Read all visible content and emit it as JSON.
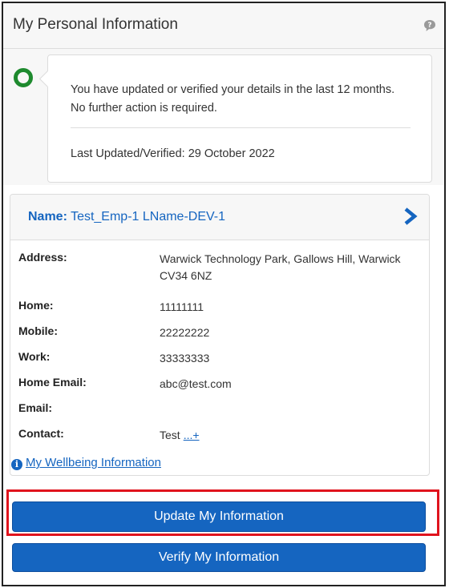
{
  "panel": {
    "title": "My Personal Information",
    "help_icon": "question-bubble-icon"
  },
  "status": {
    "icon": "circle-ring-icon",
    "icon_color": "#1e8a2e",
    "message_line1": "You have updated or verified your details in the last 12 months.",
    "message_line2": "No further action is required.",
    "last_updated": "Last Updated/Verified: 29 October 2022"
  },
  "person": {
    "name_label": "Name:",
    "name_value": "Test_Emp-1 LName-DEV-1",
    "chevron_icon": "chevron-right-icon",
    "fields": [
      {
        "key": "Address:",
        "value": "Warwick Technology Park, Gallows Hill, Warwick CV34 6NZ"
      },
      {
        "key": "Home:",
        "value": "11111111"
      },
      {
        "key": "Mobile:",
        "value": "22222222"
      },
      {
        "key": "Work:",
        "value": "33333333"
      },
      {
        "key": "Home Email:",
        "value": "abc@test.com"
      },
      {
        "key": "Email:",
        "value": ""
      },
      {
        "key": "Contact:",
        "value": "Test",
        "more": "...+"
      }
    ]
  },
  "wellbeing": {
    "icon": "info-icon",
    "link_text": "My Wellbeing Information"
  },
  "buttons": {
    "update": "Update My Information",
    "verify": "Verify My Information"
  },
  "colors": {
    "accent": "#1565c0",
    "highlight": "#e0131d"
  }
}
